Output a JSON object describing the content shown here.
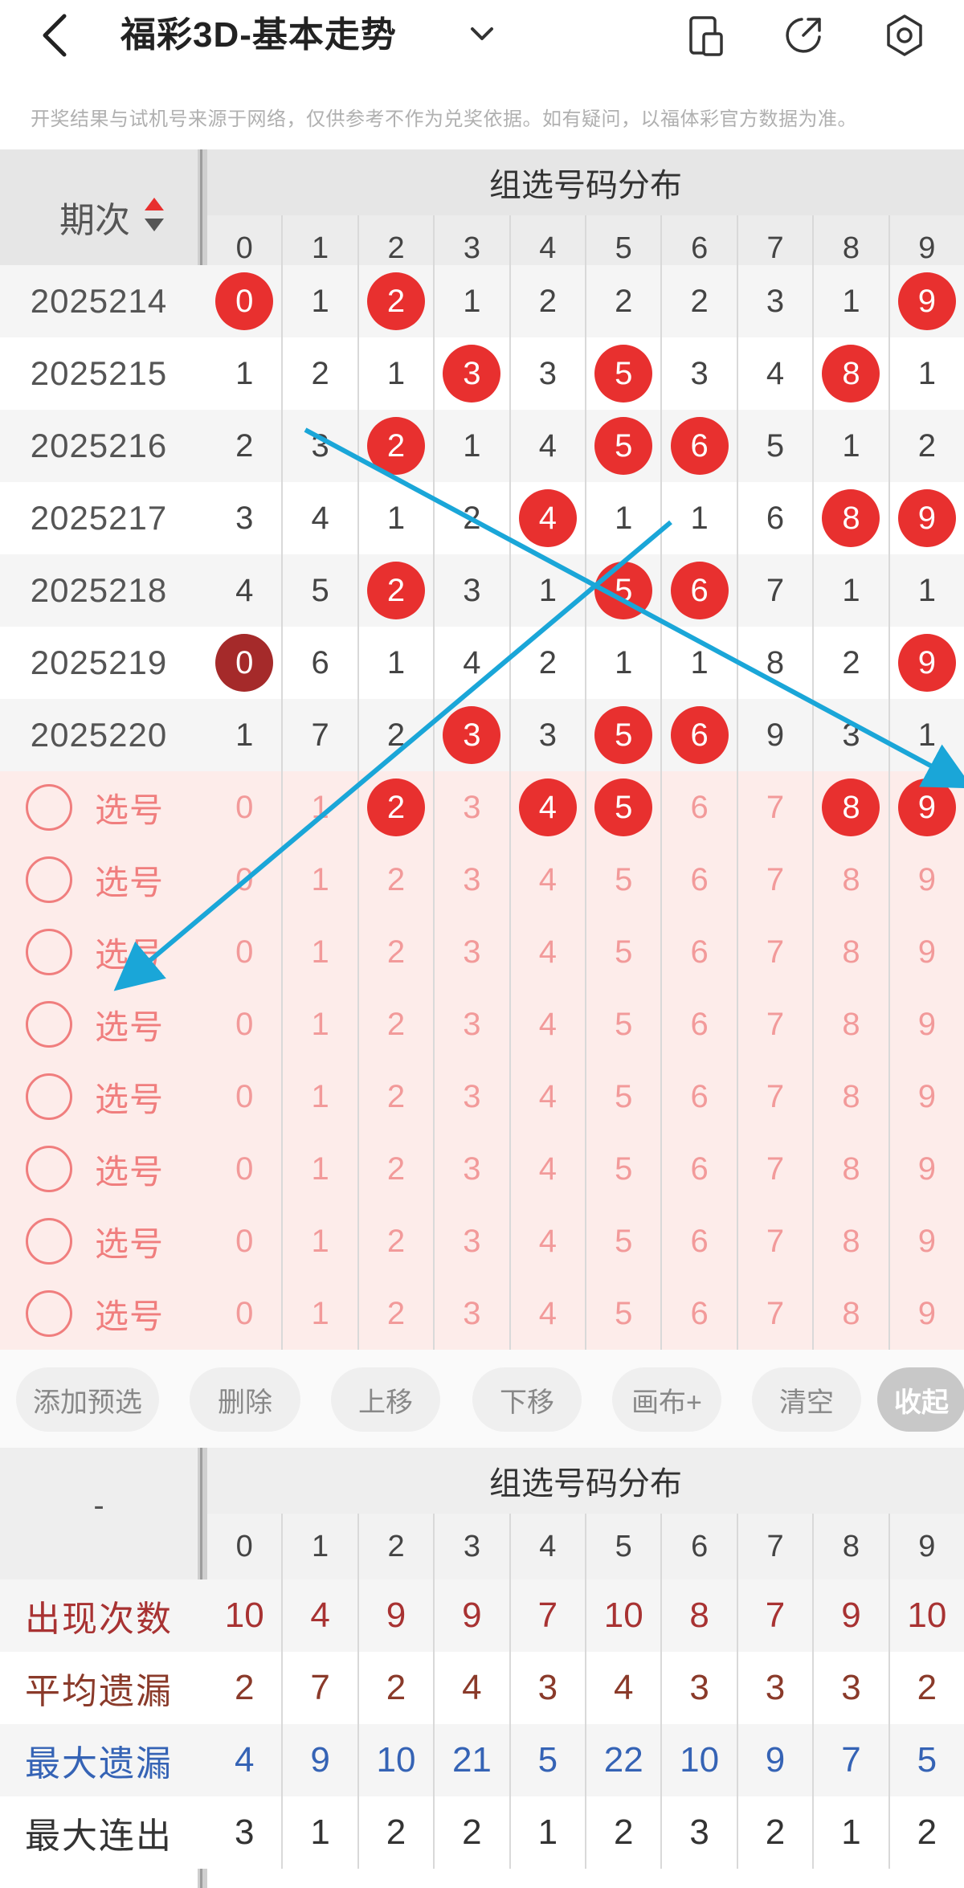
{
  "header": {
    "title": "福彩3D-基本走势",
    "notice": "开奖结果与试机号来源于网络，仅供参考不作为兑奖依据。如有疑问，以福体彩官方数据为准。"
  },
  "main_table": {
    "issue_header": "期次",
    "dist_header": "组选号码分布",
    "digits": [
      "0",
      "1",
      "2",
      "3",
      "4",
      "5",
      "6",
      "7",
      "8",
      "9"
    ],
    "rows": [
      {
        "issue": "2025214",
        "cells": [
          "0",
          "1",
          "2",
          "1",
          "2",
          "2",
          "2",
          "3",
          "1",
          "9"
        ],
        "hits": [
          0,
          2,
          9
        ],
        "dark": []
      },
      {
        "issue": "2025215",
        "cells": [
          "1",
          "2",
          "1",
          "3",
          "3",
          "5",
          "3",
          "4",
          "8",
          "1"
        ],
        "hits": [
          3,
          5,
          8
        ],
        "dark": []
      },
      {
        "issue": "2025216",
        "cells": [
          "2",
          "3",
          "2",
          "1",
          "4",
          "5",
          "6",
          "5",
          "1",
          "2"
        ],
        "hits": [
          2,
          5,
          6
        ],
        "dark": []
      },
      {
        "issue": "2025217",
        "cells": [
          "3",
          "4",
          "1",
          "2",
          "4",
          "1",
          "1",
          "6",
          "8",
          "9"
        ],
        "hits": [
          4,
          8,
          9
        ],
        "dark": []
      },
      {
        "issue": "2025218",
        "cells": [
          "4",
          "5",
          "2",
          "3",
          "1",
          "5",
          "6",
          "7",
          "1",
          "1"
        ],
        "hits": [
          2,
          5,
          6
        ],
        "dark": []
      },
      {
        "issue": "2025219",
        "cells": [
          "0",
          "6",
          "1",
          "4",
          "2",
          "1",
          "1",
          "8",
          "2",
          "9"
        ],
        "hits": [
          0,
          9
        ],
        "dark": [
          0
        ]
      },
      {
        "issue": "2025220",
        "cells": [
          "1",
          "7",
          "2",
          "3",
          "3",
          "5",
          "6",
          "9",
          "3",
          "1"
        ],
        "hits": [
          3,
          5,
          6
        ],
        "dark": []
      }
    ],
    "pick_label": "选号",
    "pick_rows": [
      {
        "hits": [
          2,
          4,
          5,
          8,
          9
        ]
      },
      {
        "hits": []
      },
      {
        "hits": []
      },
      {
        "hits": []
      },
      {
        "hits": []
      },
      {
        "hits": []
      },
      {
        "hits": []
      },
      {
        "hits": []
      }
    ]
  },
  "toolbar": {
    "buttons": [
      "添加预选",
      "删除",
      "上移",
      "下移",
      "画布+",
      "清空",
      "收起"
    ]
  },
  "stats_table": {
    "corner": "-",
    "dist_header": "组选号码分布",
    "digits": [
      "0",
      "1",
      "2",
      "3",
      "4",
      "5",
      "6",
      "7",
      "8",
      "9"
    ],
    "rows": [
      {
        "label": "出现次数",
        "color": "#a83232",
        "values": [
          "10",
          "4",
          "9",
          "9",
          "7",
          "10",
          "8",
          "7",
          "9",
          "10"
        ]
      },
      {
        "label": "平均遗漏",
        "color": "#8a3a2a",
        "values": [
          "2",
          "7",
          "2",
          "4",
          "3",
          "4",
          "3",
          "3",
          "3",
          "2"
        ]
      },
      {
        "label": "最大遗漏",
        "color": "#3563b5",
        "values": [
          "4",
          "9",
          "10",
          "21",
          "5",
          "22",
          "10",
          "9",
          "7",
          "5"
        ]
      },
      {
        "label": "最大连出",
        "color": "#333333",
        "values": [
          "3",
          "1",
          "2",
          "2",
          "1",
          "2",
          "3",
          "2",
          "1",
          "2"
        ]
      }
    ]
  },
  "colors": {
    "ball": "#e8302f",
    "ball_dark": "#a52a2a",
    "pick_bg": "#fdecea",
    "arrow": "#1aa6d8"
  }
}
